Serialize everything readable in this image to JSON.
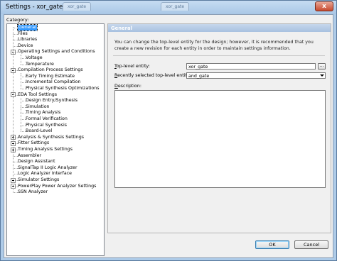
{
  "window": {
    "title": "Settings - xor_gate",
    "background_tabs": [
      "xor_gate",
      "xor_gate"
    ],
    "close_glyph": "x",
    "titlebar_color": "#aecbe8"
  },
  "category_label": "Category:",
  "tree": {
    "items": [
      {
        "label": "General",
        "level": 0,
        "expander": "none",
        "selected": true
      },
      {
        "label": "Files",
        "level": 0,
        "expander": "none"
      },
      {
        "label": "Libraries",
        "level": 0,
        "expander": "none"
      },
      {
        "label": "Device",
        "level": 0,
        "expander": "none"
      },
      {
        "label": "Operating Settings and Conditions",
        "level": 0,
        "expander": "minus"
      },
      {
        "label": "Voltage",
        "level": 1,
        "expander": "none"
      },
      {
        "label": "Temperature",
        "level": 1,
        "expander": "none"
      },
      {
        "label": "Compilation Process Settings",
        "level": 0,
        "expander": "minus"
      },
      {
        "label": "Early Timing Estimate",
        "level": 1,
        "expander": "none"
      },
      {
        "label": "Incremental Compilation",
        "level": 1,
        "expander": "none"
      },
      {
        "label": "Physical Synthesis Optimizations",
        "level": 1,
        "expander": "none"
      },
      {
        "label": "EDA Tool Settings",
        "level": 0,
        "expander": "minus"
      },
      {
        "label": "Design Entry/Synthesis",
        "level": 1,
        "expander": "none"
      },
      {
        "label": "Simulation",
        "level": 1,
        "expander": "none"
      },
      {
        "label": "Timing Analysis",
        "level": 1,
        "expander": "none"
      },
      {
        "label": "Formal Verification",
        "level": 1,
        "expander": "none"
      },
      {
        "label": "Physical Synthesis",
        "level": 1,
        "expander": "none"
      },
      {
        "label": "Board-Level",
        "level": 1,
        "expander": "none"
      },
      {
        "label": "Analysis & Synthesis Settings",
        "level": 0,
        "expander": "plus"
      },
      {
        "label": "Fitter Settings",
        "level": 0,
        "expander": "plus"
      },
      {
        "label": "Timing Analysis Settings",
        "level": 0,
        "expander": "plus"
      },
      {
        "label": "Assembler",
        "level": 0,
        "expander": "none"
      },
      {
        "label": "Design Assistant",
        "level": 0,
        "expander": "none"
      },
      {
        "label": "SignalTap II Logic Analyzer",
        "level": 0,
        "expander": "none"
      },
      {
        "label": "Logic Analyzer Interface",
        "level": 0,
        "expander": "none"
      },
      {
        "label": "Simulator Settings",
        "level": 0,
        "expander": "plus"
      },
      {
        "label": "PowerPlay Power Analyzer Settings",
        "level": 0,
        "expander": "plus"
      },
      {
        "label": "SSN Analyzer",
        "level": 0,
        "expander": "none"
      }
    ]
  },
  "panel": {
    "header": "General",
    "info_text": "You can change the top-level entity for the design; however, it is recommended that you create a new revision for each entity in order to maintain settings information.",
    "top_level_label": "Top-level entity:",
    "top_level_value": "xor_gate",
    "browse_label": "...",
    "recent_label": "Recently selected top-level entities:",
    "recent_value": "and_gate",
    "description_label": "Description:",
    "description_value": ""
  },
  "buttons": {
    "ok": "OK",
    "cancel": "Cancel"
  },
  "icons": {
    "close": "close-icon",
    "dropdown": "chevron-down-icon"
  }
}
